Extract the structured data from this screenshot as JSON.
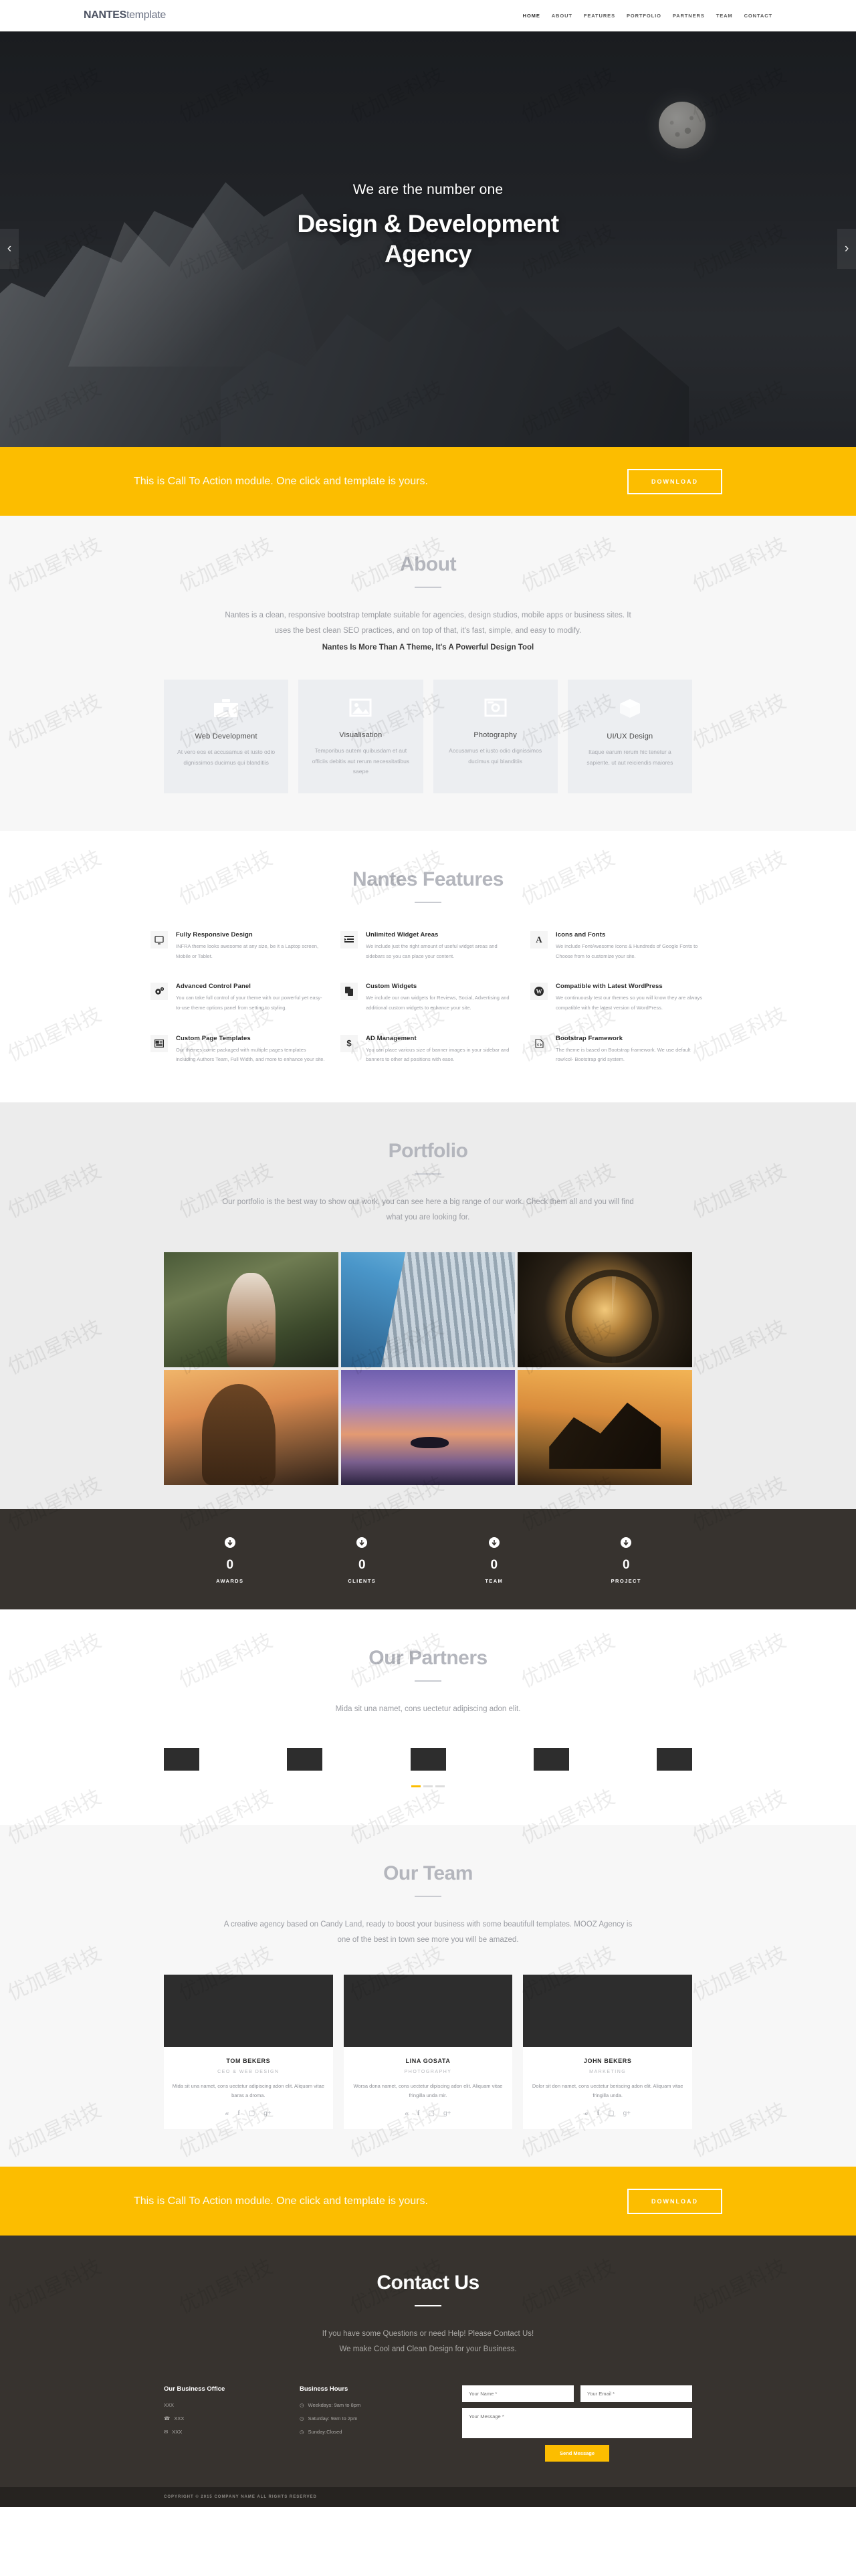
{
  "header": {
    "logo_bold": "NANTES",
    "logo_light": "template",
    "nav": [
      {
        "label": "HOME",
        "active": true
      },
      {
        "label": "ABOUT",
        "active": false
      },
      {
        "label": "FEATURES",
        "active": false
      },
      {
        "label": "PORTFOLIO",
        "active": false
      },
      {
        "label": "PARTNERS",
        "active": false
      },
      {
        "label": "TEAM",
        "active": false
      },
      {
        "label": "CONTACT",
        "active": false
      }
    ]
  },
  "hero": {
    "subtitle": "We are the number one",
    "title_line1": "Design & Development",
    "title_line2": "Agency",
    "prev_icon": "chevron-left-icon",
    "next_icon": "chevron-right-icon"
  },
  "cta": {
    "text": "This is Call To Action module. One click and template is yours.",
    "button": "DOWNLOAD"
  },
  "about": {
    "title": "About",
    "desc": "Nantes is a clean, responsive bootstrap template suitable for agencies, design studios, mobile apps or business sites. It uses the best clean SEO practices, and on top of that, it's fast, simple, and easy to modify.",
    "desc_bold": "Nantes Is More Than A Theme, It's A Powerful Design Tool",
    "cards": [
      {
        "icon": "briefcase-icon",
        "title": "Web Development",
        "text": "At vero eos et accusamus et iusto odio dignissimos ducimus qui blanditiis"
      },
      {
        "icon": "image-icon",
        "title": "Visualisation",
        "text": "Temporibus autem quibusdam et aut officiis debitis aut rerum necessitatibus saepe"
      },
      {
        "icon": "camera-icon",
        "title": "Photography",
        "text": "Accusamus et iusto odio dignissimos ducimus qui blanditiis"
      },
      {
        "icon": "box-icon",
        "title": "UI/UX Design",
        "text": "Itaque earum rerum hic tenetur a sapiente, ut aut reiciendis maiores"
      }
    ]
  },
  "features": {
    "title": "Nantes Features",
    "items": [
      {
        "icon": "monitor-icon",
        "glyph": "❐",
        "title": "Fully Responsive Design",
        "text": "INFRA theme looks awesome at any size, be it a Laptop screen, Mobile or Tablet."
      },
      {
        "icon": "list-icon",
        "glyph": "≡",
        "title": "Unlimited Widget Areas",
        "text": "We include just the right amount of useful widget areas and sidebars so you can place your content."
      },
      {
        "icon": "font-icon",
        "glyph": "A",
        "title": "Icons and Fonts",
        "text": "We include FontAwesome Icons & Hundreds of Google Fonts to Choose from to customize your site."
      },
      {
        "icon": "gears-icon",
        "glyph": "⚙",
        "title": "Advanced Control Panel",
        "text": "You can take full control of your theme with our powerful yet easy-to-use theme options panel from setting to styling."
      },
      {
        "icon": "copy-icon",
        "glyph": "❐",
        "title": "Custom Widgets",
        "text": "We include our own widgets for Reviews, Social, Advertising and additional custom widgets to enhance your site."
      },
      {
        "icon": "wordpress-icon",
        "glyph": "Ⓦ",
        "title": "Compatible with Latest WordPress",
        "text": "We continuously test our themes so you will know they are always compatible with the latest version of WordPress."
      },
      {
        "icon": "newspaper-icon",
        "glyph": "▤",
        "title": "Custom Page Templates",
        "text": "Our themes come packaged with multiple pages templates including Authors Team, Full Width, and more to enhance your site."
      },
      {
        "icon": "dollar-icon",
        "glyph": "$",
        "title": "AD Management",
        "text": "You can place various size of banner images in your sidebar and banners to other ad positions with ease."
      },
      {
        "icon": "code-icon",
        "glyph": "‹›",
        "title": "Bootstrap Framework",
        "text": "The theme is based on Bootstrap framework. We use default row/col- Bootstrap grid system."
      }
    ]
  },
  "portfolio": {
    "title": "Portfolio",
    "desc": "Our portfolio is the best way to show our work, you can see here a big range of our work. Check them all and you will find what you are looking for.",
    "items": [
      {
        "name": "portrait-woman-forest"
      },
      {
        "name": "modern-architecture-blue"
      },
      {
        "name": "cathedral-rose-window"
      },
      {
        "name": "woman-sunset-field"
      },
      {
        "name": "boat-purple-lake"
      },
      {
        "name": "hands-sunset-silhouette"
      }
    ]
  },
  "counters": [
    {
      "value": "0",
      "label": "AWARDS",
      "icon": "arrow-down-circle-icon"
    },
    {
      "value": "0",
      "label": "CLIENTS",
      "icon": "arrow-down-circle-icon"
    },
    {
      "value": "0",
      "label": "TEAM",
      "icon": "arrow-down-circle-icon"
    },
    {
      "value": "0",
      "label": "PROJECT",
      "icon": "arrow-down-circle-icon"
    }
  ],
  "partners": {
    "title": "Our Partners",
    "desc": "Mida sit una namet, cons uectetur adipiscing adon elit.",
    "logos": [
      "partner-logo-1",
      "partner-logo-2",
      "partner-logo-3",
      "partner-logo-4",
      "partner-logo-5"
    ],
    "active_dot": 0
  },
  "team": {
    "title": "Our Team",
    "desc": "A creative agency based on Candy Land, ready to boost your business with some beautifull templates. MOOZ Agency is one of the best in town see more you will be amazed.",
    "members": [
      {
        "name": "TOM BEKERS",
        "role": "CEO & WEB DESIGN",
        "bio": "Mida sit una namet, cons uectetur adipiscing adon elit. Aliquam vitae baras a droma."
      },
      {
        "name": "LINA GOSATA",
        "role": "PHOTOGRAPHY",
        "bio": "Worsa dona namet, cons uectetur dipiscing adon elit. Aliquam vitae fringilla unda mir."
      },
      {
        "name": "JOHN BEKERS",
        "role": "MARKETING",
        "bio": "Dolor sit don namet, cons uectetur beriscing adon elit. Aliquam vitae fringilla unda."
      }
    ],
    "social": [
      "twitter-icon",
      "facebook-icon",
      "youtube-icon",
      "google-plus-icon"
    ]
  },
  "cta2": {
    "text": "This is Call To Action module. One click and template is yours.",
    "button": "DOWNLOAD"
  },
  "contact": {
    "title": "Contact Us",
    "desc_line1": "If you have some Questions or need Help! Please Contact Us!",
    "desc_line2": "We make Cool and Clean Design for your Business.",
    "office_title": "Our Business Office",
    "office_lines": [
      {
        "icon": "",
        "text": "XXX"
      },
      {
        "icon": "phone-icon",
        "text": "XXX"
      },
      {
        "icon": "envelope-icon",
        "text": "XXX"
      }
    ],
    "hours_title": "Business Hours",
    "hours_lines": [
      {
        "icon": "clock-icon",
        "text": "Weekdays: 9am to 8pm"
      },
      {
        "icon": "clock-icon",
        "text": "Saturday: 9am to 2pm"
      },
      {
        "icon": "clock-icon",
        "text": "Sunday:Closed"
      }
    ],
    "name_placeholder": "Your Name *",
    "email_placeholder": "Your Email *",
    "message_placeholder": "Your Message *",
    "send_label": "Send Message"
  },
  "footer": {
    "copyright": "COPYRIGHT © 2015 COMPANY NAME ALL RIGHTS RESERVED"
  },
  "colors": {
    "accent": "#fcbd00",
    "dark": "#37332f",
    "footer": "#262320"
  }
}
